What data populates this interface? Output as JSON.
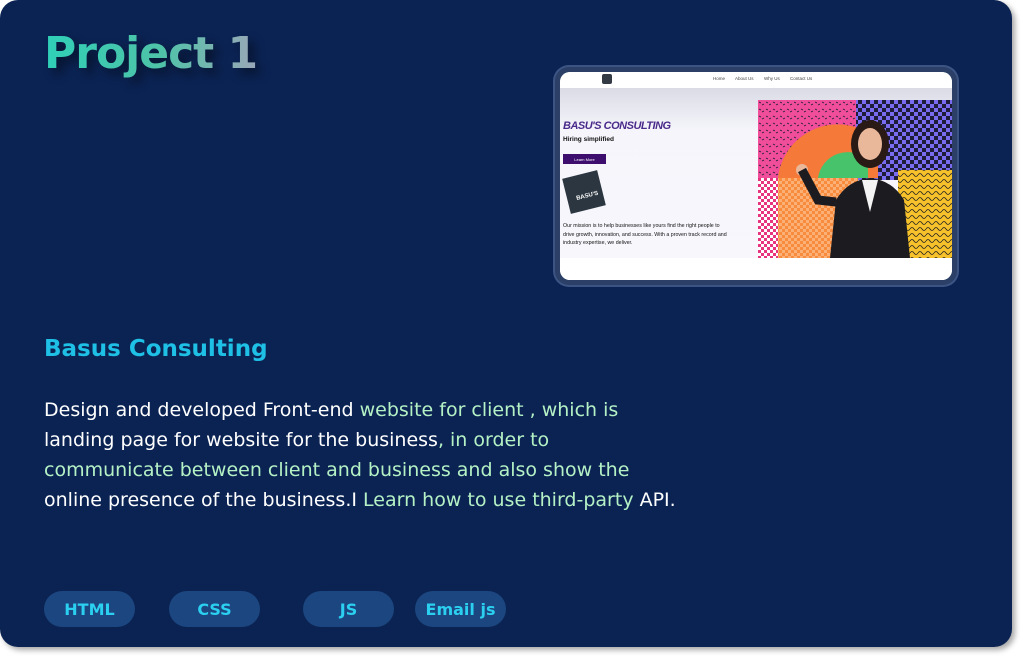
{
  "project": {
    "title": "Project 1",
    "name": "Basus Consulting",
    "description": [
      {
        "text": "Design and developed Front-end ",
        "highlight": false
      },
      {
        "text": "website for client , which is",
        "highlight": true
      },
      {
        "text": " landing page for website for the business",
        "highlight": false
      },
      {
        "text": ", in order to communicate between client and business and",
        "highlight": false
      },
      {
        "text": " also show the",
        "highlight": true
      },
      {
        "text": " online presence of the business.I ",
        "highlight": false
      },
      {
        "text": "Learn how to use third-party",
        "highlight": true
      },
      {
        "text": " API.",
        "highlight": false
      }
    ],
    "tags": [
      "HTML",
      "CSS",
      "JS",
      "Email js"
    ]
  },
  "preview": {
    "nav": [
      "Home",
      "About Us",
      "Why Us",
      "Contact Us"
    ],
    "hero_title": "BASU'S CONSULTING",
    "hero_subtitle": "Hiring simplified",
    "button": "Learn More",
    "badge_text": "BASU'S",
    "mission": "Our mission is to help businesses like yours find the right people to drive growth, innovation, and success. With a proven track record and industry expertise, we deliver."
  },
  "colors": {
    "card_bg": "#0b2353",
    "title_gradient_start": "#2fd0b7",
    "subtitle": "#1ec0e6",
    "highlight_text": "#b4f1c5",
    "tag_bg": "#1c4680",
    "tag_text": "#2bd0f0"
  }
}
